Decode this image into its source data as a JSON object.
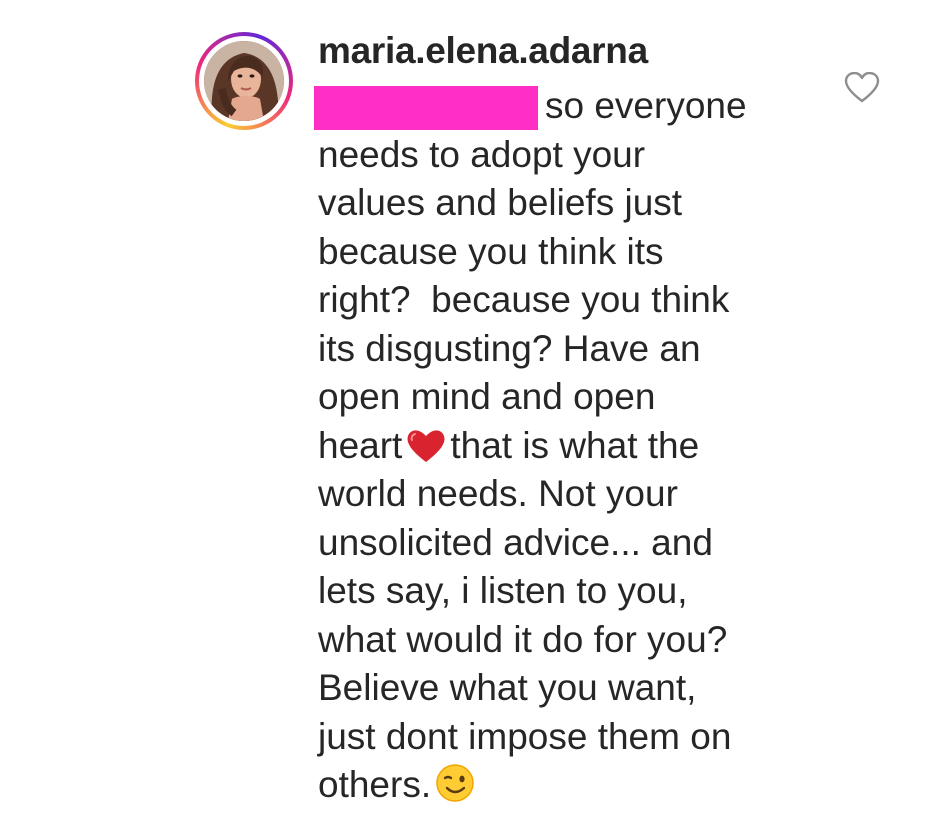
{
  "comment": {
    "username": "maria.elena.adarna",
    "lines": [
      "so everyone",
      "needs to adopt your",
      "values and beliefs just",
      "because you think its",
      "right?  because you think",
      "its disgusting? Have an",
      "open mind and open",
      "heart",
      "that is what the",
      "world needs. Not your",
      "unsolicited advice... and",
      "lets say, i listen to you,",
      "what would it do for you?",
      "Believe what you want,",
      "just dont impose them on",
      "others."
    ],
    "inline_emojis": [
      "red-heart-emoji",
      "winking-face-emoji"
    ],
    "like_icon": "heart-outline-icon",
    "colors": {
      "text": "#262626",
      "redaction": "#ff2ec4",
      "like_icon": "#8e8e8e"
    }
  }
}
